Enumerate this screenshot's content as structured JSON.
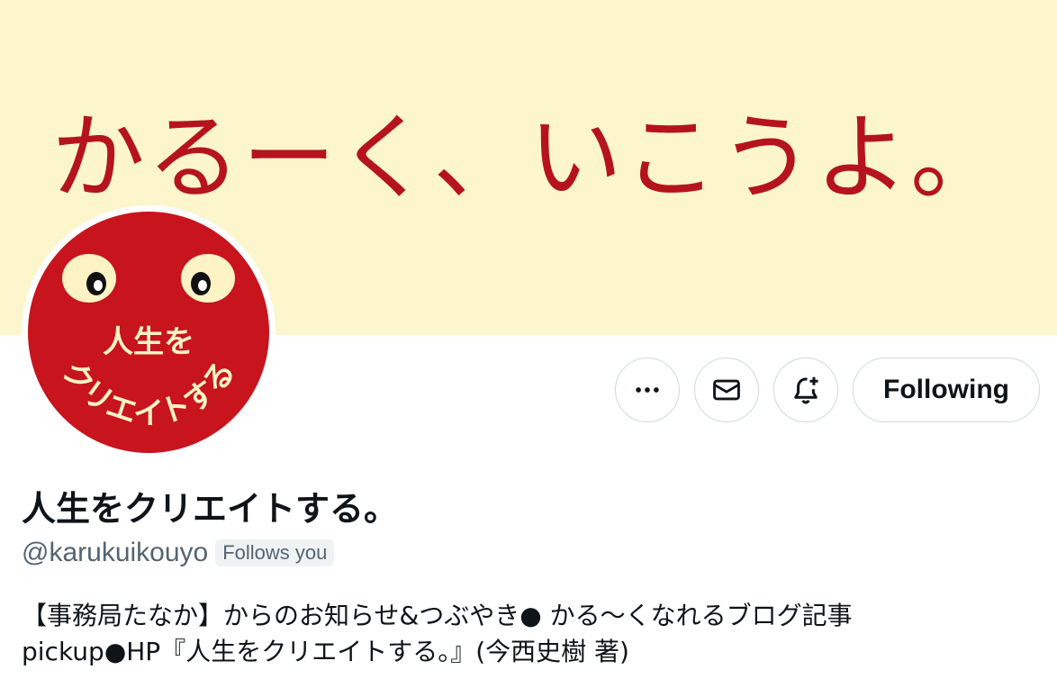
{
  "banner": {
    "text": "かるーく、いこうよ。",
    "background": "#fdf6cd",
    "text_color": "#b5141c"
  },
  "avatar": {
    "line1": "人生を",
    "line2": "クリエイトする",
    "circle_color": "#c8141c"
  },
  "actions": {
    "more_icon": "more-horizontal-icon",
    "message_icon": "envelope-icon",
    "notify_icon": "bell-plus-icon",
    "follow_label": "Following"
  },
  "profile": {
    "display_name": "人生をクリエイトする。",
    "handle": "@karukuikouyo",
    "follows_you": "Follows you",
    "bio_line1": "【事務局たなか】からのお知らせ&つぶやき● かる〜くなれるブログ記事",
    "bio_line2": "pickup●HP『人生をクリエイトする。』(今西史樹 著)"
  }
}
